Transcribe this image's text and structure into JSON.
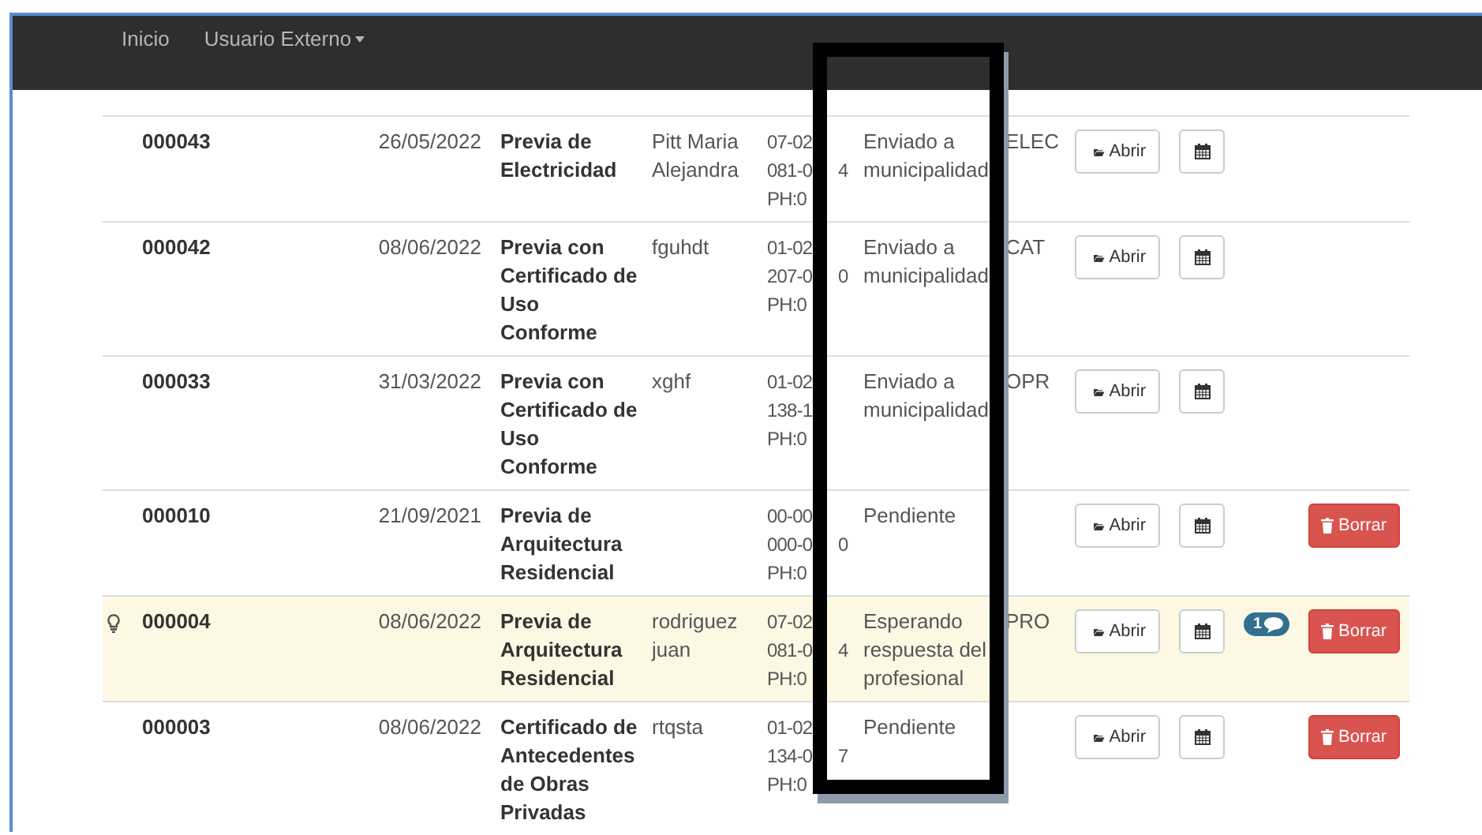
{
  "navbar": {
    "links": [
      {
        "label": "Inicio",
        "kind": "link"
      },
      {
        "label": "Usuario Externo",
        "kind": "dropdown"
      }
    ]
  },
  "rows": [
    {
      "id": "000043",
      "date": "26/05/2022",
      "title": "Previa de Electricidad",
      "name": "Pitt Maria Alejandra",
      "address": [
        {
          "text": "07-02"
        },
        {
          "text": "081-0",
          "tail": "4"
        },
        {
          "text": "PH:0"
        }
      ],
      "status": "Enviado a municipalidad",
      "code": "ELEC",
      "highlighted": false,
      "hint": false,
      "actions": [
        {
          "kind": "open",
          "label": "Abrir"
        },
        {
          "kind": "calendar"
        }
      ]
    },
    {
      "id": "000042",
      "date": "08/06/2022",
      "title": "Previa con Certificado de Uso Conforme",
      "name": "fguhdt",
      "address": [
        {
          "text": "01-02"
        },
        {
          "text": "207-0",
          "tail": "0"
        },
        {
          "text": "PH:0"
        }
      ],
      "status": "Enviado a municipalidad",
      "code": "CAT",
      "highlighted": false,
      "hint": false,
      "actions": [
        {
          "kind": "open",
          "label": "Abrir"
        },
        {
          "kind": "calendar"
        }
      ]
    },
    {
      "id": "000033",
      "date": "31/03/2022",
      "title": "Previa con Certificado de Uso Conforme",
      "name": "xghf",
      "address": [
        {
          "text": "01-02"
        },
        {
          "text": "138-1"
        },
        {
          "text": "PH:0"
        }
      ],
      "status": "Enviado a municipalidad",
      "code": "OPR",
      "highlighted": false,
      "hint": false,
      "actions": [
        {
          "kind": "open",
          "label": "Abrir"
        },
        {
          "kind": "calendar"
        }
      ]
    },
    {
      "id": "000010",
      "date": "21/09/2021",
      "title": "Previa de Arquitectura Residencial",
      "address": [
        {
          "text": "00-00"
        },
        {
          "text": "000-0",
          "tail": "0"
        },
        {
          "text": "PH:0"
        }
      ],
      "status": "Pendiente",
      "highlighted": false,
      "hint": false,
      "actions": [
        {
          "kind": "open",
          "label": "Abrir"
        },
        {
          "kind": "calendar"
        },
        {
          "kind": "delete",
          "label": "Borrar"
        }
      ]
    },
    {
      "id": "000004",
      "date": "08/06/2022",
      "title": "Previa de Arquitectura Residencial",
      "name": "rodriguez juan",
      "address": [
        {
          "text": "07-02"
        },
        {
          "text": "081-0",
          "tail": "4"
        },
        {
          "text": "PH:0"
        }
      ],
      "status": "Esperando respuesta del profesional",
      "code": "PRO",
      "highlighted": true,
      "hint": true,
      "actions": [
        {
          "kind": "open",
          "label": "Abrir"
        },
        {
          "kind": "calendar"
        },
        {
          "kind": "comments",
          "label": "1"
        },
        {
          "kind": "delete",
          "label": "Borrar"
        }
      ]
    },
    {
      "id": "000003",
      "date": "08/06/2022",
      "title": "Certificado de Antecedentes de Obras Privadas",
      "name": "rtqsta",
      "address": [
        {
          "text": "01-02"
        },
        {
          "text": "134-0",
          "tail": "7"
        },
        {
          "text": "PH:0"
        }
      ],
      "status": "Pendiente",
      "highlighted": false,
      "hint": false,
      "actions": [
        {
          "kind": "open",
          "label": "Abrir"
        },
        {
          "kind": "calendar"
        },
        {
          "kind": "delete",
          "label": "Borrar"
        }
      ]
    }
  ]
}
